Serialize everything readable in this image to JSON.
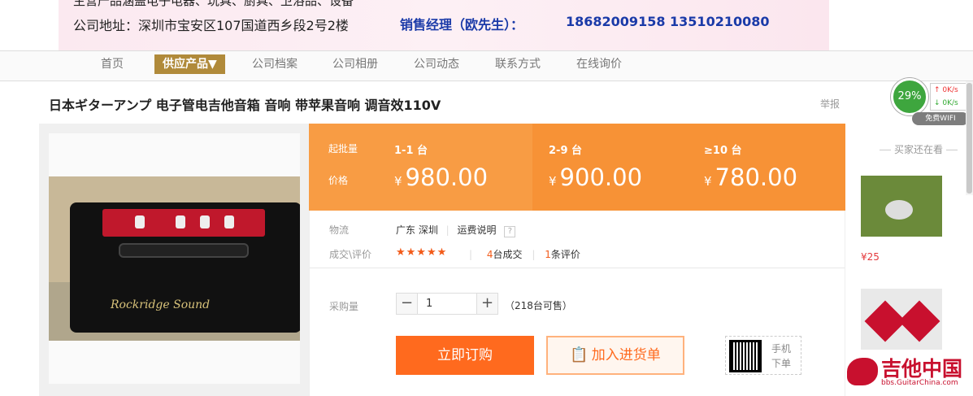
{
  "banner": {
    "cut_text": "主营产品涵盖电子电器、玩具、厨具、卫浴品、设备",
    "address": "公司地址：深圳市宝安区107国道西乡段2号2楼",
    "manager": "销售经理（欧先生）：",
    "phones": "18682009158  13510210080"
  },
  "nav": {
    "items": [
      "首页",
      "供应产品▼",
      "公司档案",
      "公司相册",
      "公司动态",
      "联系方式",
      "在线询价"
    ]
  },
  "product": {
    "title": "日本ギターアンプ 电子管电吉他音箱 音响 带苹果音响 调音效110V",
    "report": "举报",
    "amp_brand": "Rockridge Sound"
  },
  "pricing": {
    "moq_label": "起批量",
    "price_label": "价格",
    "tiers": [
      {
        "qty": "1-1 台",
        "currency": "¥",
        "price": "980.00"
      },
      {
        "qty": "2-9 台",
        "currency": "¥",
        "price": "900.00"
      },
      {
        "qty": "≥10 台",
        "currency": "¥",
        "price": "780.00"
      }
    ]
  },
  "logistics": {
    "label": "物流",
    "location": "广东 深圳",
    "shipping_link": "运费说明",
    "help": "?"
  },
  "deals": {
    "label": "成交\\评价",
    "stars": "★★★★★",
    "sold_count": "4",
    "sold_unit": "台成交",
    "review_count": "1",
    "review_unit": "条评价"
  },
  "purchase": {
    "label": "采购量",
    "minus": "−",
    "plus": "+",
    "quantity": "1",
    "stock": "（218台可售）",
    "buy_now": "立即订购",
    "add_cart": "加入进货单",
    "mobile_order": "手机下单"
  },
  "sidebar": {
    "heading": "买家还在看",
    "item1_price": "¥25"
  },
  "net_widget": {
    "percent": "29%",
    "up_speed": "↑ 0K/s",
    "down_speed": "↓ 0K/s",
    "wifi_label": "免费WIFI"
  },
  "watermark": {
    "title": "吉他中国",
    "url": "bbs.GuitarChina.com"
  },
  "colors": {
    "accent_orange": "#ff6a1e",
    "price_bar": "#f89c44",
    "nav_active": "#b08a3a",
    "banner_blue": "#1a3aa8"
  }
}
